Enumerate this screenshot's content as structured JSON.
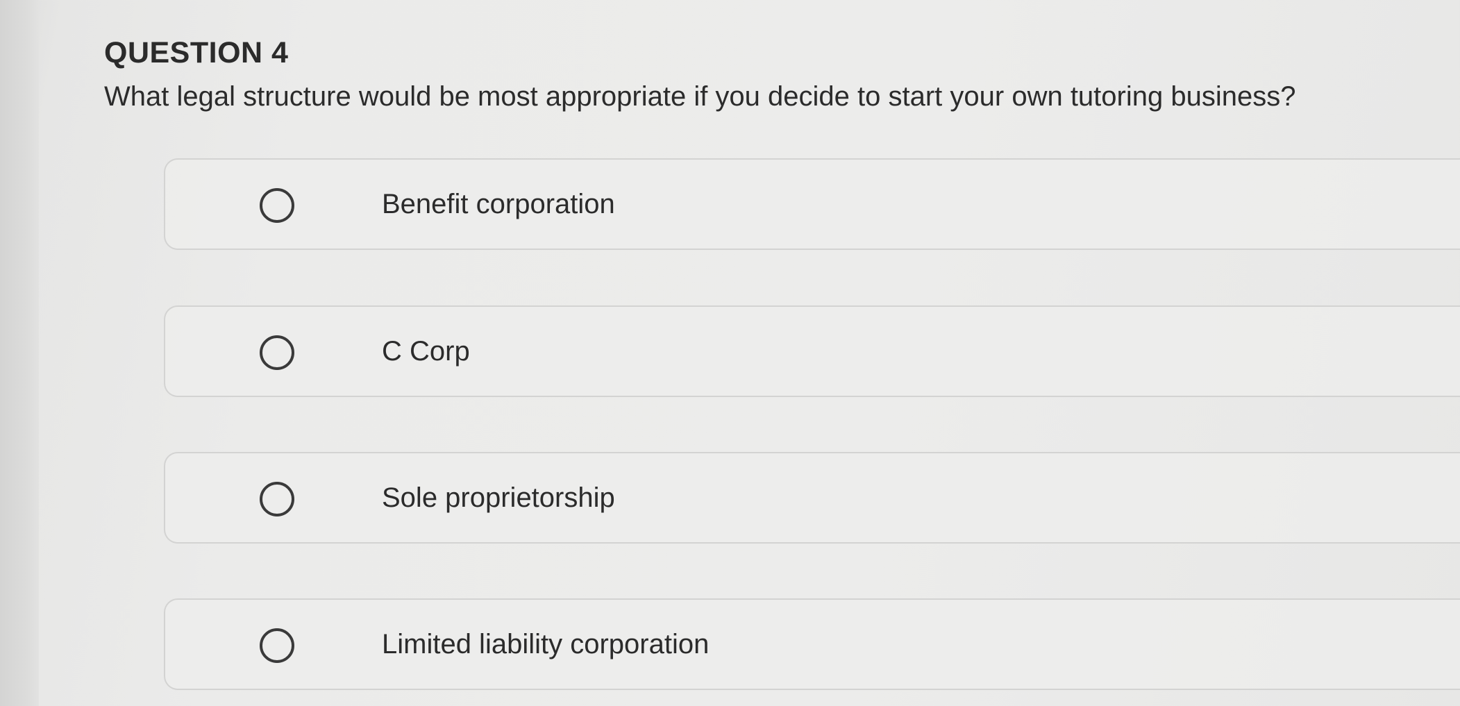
{
  "question": {
    "number_label": "QUESTION 4",
    "text": "What legal structure would be most appropriate if you decide to start your own tutoring business?"
  },
  "options": [
    {
      "label": "Benefit corporation",
      "selected": false
    },
    {
      "label": "C Corp",
      "selected": false
    },
    {
      "label": "Sole proprietorship",
      "selected": false
    },
    {
      "label": "Limited liability corporation",
      "selected": false
    }
  ]
}
